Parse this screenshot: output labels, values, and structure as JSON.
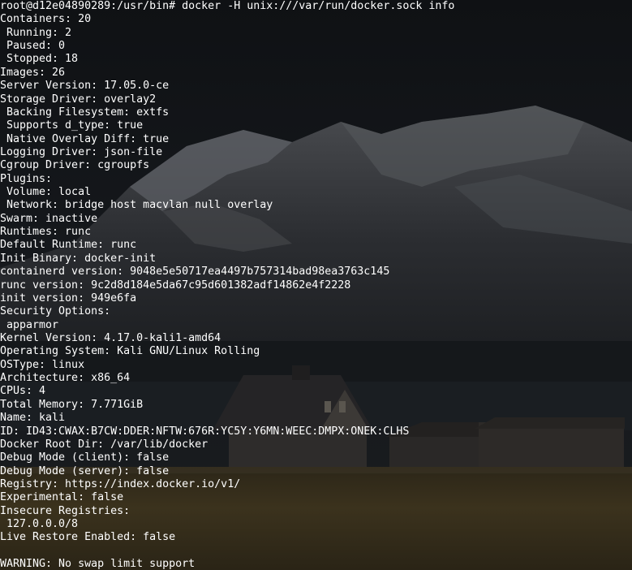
{
  "terminal": {
    "lines": [
      "root@d12e04890289:/usr/bin# docker -H unix:///var/run/docker.sock info",
      "Containers: 20",
      " Running: 2",
      " Paused: 0",
      " Stopped: 18",
      "Images: 26",
      "Server Version: 17.05.0-ce",
      "Storage Driver: overlay2",
      " Backing Filesystem: extfs",
      " Supports d_type: true",
      " Native Overlay Diff: true",
      "Logging Driver: json-file",
      "Cgroup Driver: cgroupfs",
      "Plugins:",
      " Volume: local",
      " Network: bridge host macvlan null overlay",
      "Swarm: inactive",
      "Runtimes: runc",
      "Default Runtime: runc",
      "Init Binary: docker-init",
      "containerd version: 9048e5e50717ea4497b757314bad98ea3763c145",
      "runc version: 9c2d8d184e5da67c95d601382adf14862e4f2228",
      "init version: 949e6fa",
      "Security Options:",
      " apparmor",
      "Kernel Version: 4.17.0-kali1-amd64",
      "Operating System: Kali GNU/Linux Rolling",
      "OSType: linux",
      "Architecture: x86_64",
      "CPUs: 4",
      "Total Memory: 7.771GiB",
      "Name: kali",
      "ID: ID43:CWAX:B7CW:DDER:NFTW:676R:YC5Y:Y6MN:WEEC:DMPX:ONEK:CLHS",
      "Docker Root Dir: /var/lib/docker",
      "Debug Mode (client): false",
      "Debug Mode (server): false",
      "Registry: https://index.docker.io/v1/",
      "Experimental: false",
      "Insecure Registries:",
      " 127.0.0.0/8",
      "Live Restore Enabled: false",
      "",
      "WARNING: No swap limit support"
    ]
  }
}
